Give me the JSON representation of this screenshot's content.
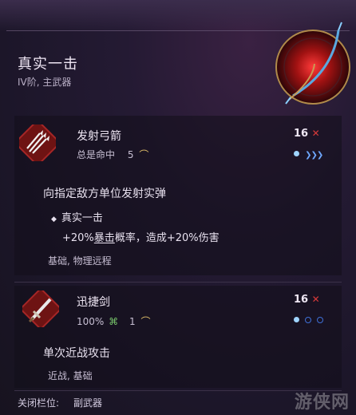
{
  "header": {
    "title": "真实一击",
    "subtitle": "IV阶, 主武器"
  },
  "actions": [
    {
      "name": "发射弓箭",
      "hit_label": "总是命中",
      "hit_value": "5",
      "range": "16",
      "description": "向指定敌方单位发射实弹",
      "bullet_title": "真实一击",
      "bullet_detail_prefix": "+20%",
      "bullet_detail_link": "暴击",
      "bullet_detail_suffix": "概率，造成+20%伤害",
      "tags": "基础, 物理远程"
    },
    {
      "name": "迅捷剑",
      "hit_label": "100%",
      "hit_value": "1",
      "range": "16",
      "description": "单次近战攻击",
      "tags": "近战, 基础"
    }
  ],
  "footer": {
    "label": "关闭栏位:",
    "value": "副武器"
  },
  "watermark": "游侠网",
  "colors": {
    "accent_red": "#d83a3a",
    "pip_blue": "#7fc0ff",
    "gold_icon": "#e2c06a"
  },
  "icons": {
    "arrows_action": "arrows-icon",
    "sword_action": "sword-icon",
    "range_marker": "crossed-arrows-icon",
    "hit_symbol": "bow-curve-icon"
  }
}
